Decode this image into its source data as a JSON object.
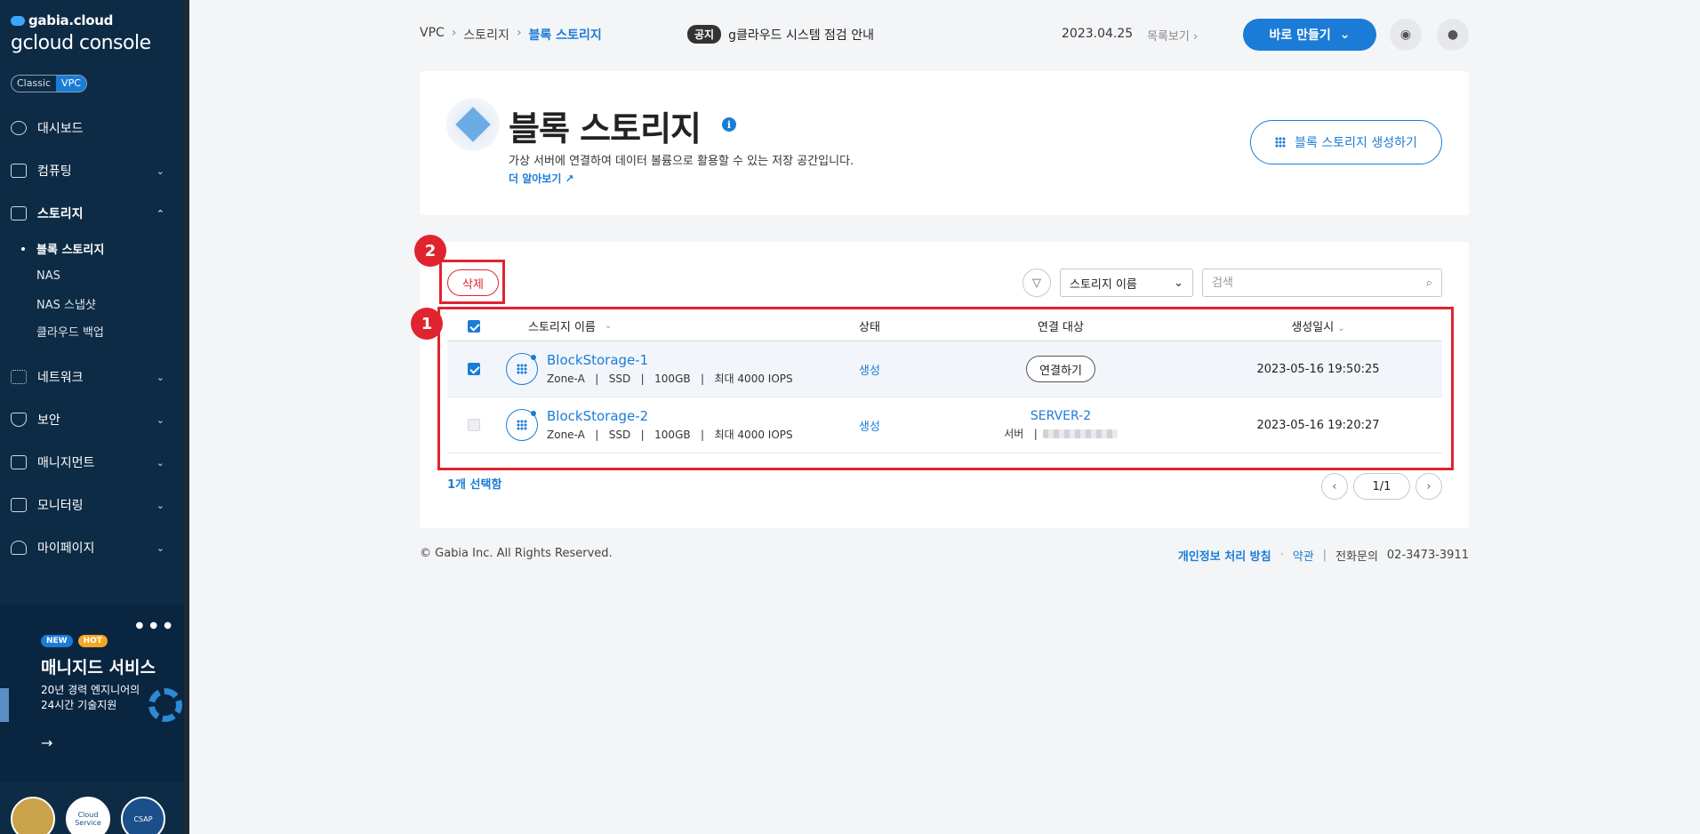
{
  "sidebar": {
    "logo_small": "gabia.cloud",
    "logo_big": "gcloud console",
    "mode": [
      "Classic",
      "VPC"
    ],
    "items": [
      {
        "label": "대시보드",
        "icon": "dashboard-icon"
      },
      {
        "label": "컴퓨팅",
        "icon": "chip-icon"
      },
      {
        "label": "스토리지",
        "icon": "storage-icon"
      },
      {
        "label": "네트워크",
        "icon": "network-icon"
      },
      {
        "label": "보안",
        "icon": "shield-icon"
      },
      {
        "label": "매니지먼트",
        "icon": "management-icon"
      },
      {
        "label": "모니터링",
        "icon": "monitor-icon"
      },
      {
        "label": "마이페이지",
        "icon": "user-icon"
      }
    ],
    "sub_items": [
      "블록 스토리지",
      "NAS",
      "NAS 스냅샷",
      "클라우드 백업"
    ],
    "promo": {
      "badge_new": "NEW",
      "badge_hot": "HOT",
      "title": "매니지드 서비스",
      "desc_line1": "20년 경력 엔지니어의",
      "desc_line2": "24시간 기술지원",
      "arrow": "→"
    },
    "certs": [
      "",
      "Cloud Service",
      "CSAP"
    ]
  },
  "topbar": {
    "breadcrumb": [
      "VPC",
      "스토리지",
      "블록 스토리지"
    ],
    "breadcrumb_sep": "›",
    "notice_tag": "공지",
    "notice_text": "g클라우드 시스템 점검 안내",
    "notice_date": "2023.04.25",
    "notice_list": "목록보기 ›",
    "create_label": "바로 만들기"
  },
  "header": {
    "title": "블록 스토리지",
    "info": "i",
    "desc": "가상 서버에 연결하여 데이터 볼륨으로 활용할 수 있는 저장 공간입니다.",
    "learn_more": "더 알아보기 ↗",
    "create_button": "블록 스토리지 생성하기"
  },
  "toolbar": {
    "delete_label": "삭제",
    "select_value": "스토리지 이름",
    "search_placeholder": "검색"
  },
  "annotations": [
    "1",
    "2"
  ],
  "table": {
    "columns": [
      "스토리지 이름",
      "상태",
      "연결 대상",
      "생성일시"
    ],
    "rows": [
      {
        "name": "BlockStorage-1",
        "meta": "Zone-A   |   SSD   |   100GB   |   최대 4000 IOPS",
        "status": "생성",
        "target_button": "연결하기",
        "date": "2023-05-16 19:50:25",
        "selected": true
      },
      {
        "name": "BlockStorage-2",
        "meta": "Zone-A   |   SSD   |   100GB   |   최대 4000 IOPS",
        "status": "생성",
        "server_name": "SERVER-2",
        "server_label": "서버   |",
        "date": "2023-05-16 19:20:27",
        "selected": false
      }
    ],
    "selected_count": "1개 선택함",
    "page": "1/1"
  },
  "footer": {
    "copyright": "© Gabia Inc. All Rights Reserved.",
    "privacy": "개인정보 처리 방침",
    "dot": "·",
    "terms": "약관",
    "bar": "|",
    "phone_label": "전화문의",
    "phone": "02-3473-3911"
  },
  "colors": {
    "sidebar_bg": "#0d2b45",
    "accent": "#1a7cd6",
    "annotation": "#e0242f"
  }
}
